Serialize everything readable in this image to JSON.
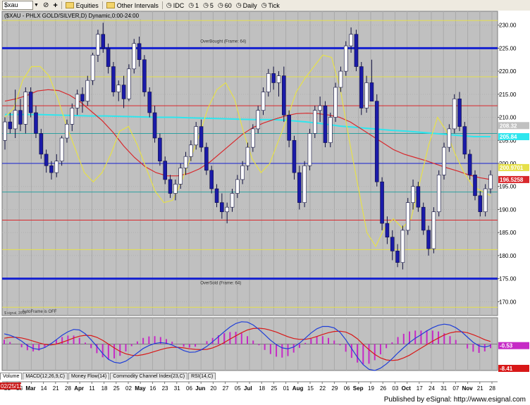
{
  "toolbar": {
    "symbol_value": "$xau",
    "equities_label": "Equities",
    "other_intervals_label": "Other Intervals",
    "intervals": [
      "IDC",
      "1",
      "5",
      "60",
      "Daily",
      "Tick"
    ]
  },
  "footer": {
    "text": "Published by eSignal: http://www.esignal.com"
  },
  "tabs": [
    "Volume",
    "MACD(12,26,9,C)",
    "Money Flow(14)",
    "Commodity Channel Index(23,C)",
    "RSI(14,C)"
  ],
  "colors": {
    "plot_bg": "#c0c0c0",
    "up_candle": "#ffffff",
    "down_candle": "#1a1aa8",
    "ma_cyan": "#2ee6ee",
    "ma_red": "#d8282c",
    "ma_yellow": "#e6e04a",
    "macd_line": "#1f3ed8",
    "signal_line": "#d81818",
    "histogram": "#c62ac6"
  },
  "chart_data": [
    {
      "type": "candlestick",
      "title": "($XAU - PHLX GOLD/SILVER,D) Dynamic,0:00-24:00",
      "ylim": [
        167,
        233
      ],
      "yticks": [
        170,
        175,
        180,
        185,
        190,
        195,
        200,
        205,
        210,
        215,
        220,
        225,
        230
      ],
      "ytick_labels": [
        "170.00",
        "175.00",
        "180.00",
        "185.00",
        "190.00",
        "195.00",
        "200.00",
        "205.00",
        "210.00",
        "215.00",
        "220.00",
        "225.00",
        "230.00"
      ],
      "x_date_labels": [
        "21",
        "28",
        "Mar",
        "14",
        "21",
        "28",
        "Apr",
        "11",
        "18",
        "25",
        "02",
        "May",
        "16",
        "23",
        "31",
        "06",
        "Jun",
        "20",
        "27",
        "05",
        "Jul",
        "18",
        "25",
        "01",
        "Aug",
        "15",
        "22",
        "29",
        "06",
        "Sep",
        "19",
        "26",
        "03",
        "Oct",
        "17",
        "24",
        "31",
        "07",
        "Nov",
        "21",
        "28"
      ],
      "date_box_label": "02/25/11",
      "horizontal_lines": [
        {
          "y": 231.0,
          "color": "#e6e04a",
          "width": 1
        },
        {
          "y": 225.0,
          "color": "#1420d0",
          "width": 3
        },
        {
          "y": 218.8,
          "color": "#e6e04a",
          "width": 1
        },
        {
          "y": 212.5,
          "color": "#d8282c",
          "width": 1
        },
        {
          "y": 206.5,
          "color": "#2ea0a0",
          "width": 1
        },
        {
          "y": 200.0,
          "color": "#1420d0",
          "width": 1
        },
        {
          "y": 193.8,
          "color": "#2ea0a0",
          "width": 1
        },
        {
          "y": 187.7,
          "color": "#d8282c",
          "width": 1
        },
        {
          "y": 181.3,
          "color": "#e6e04a",
          "width": 1
        },
        {
          "y": 175.0,
          "color": "#1420d0",
          "width": 3
        },
        {
          "y": 168.8,
          "color": "#e6e04a",
          "width": 1
        }
      ],
      "annotations": [
        {
          "text": "OverBought (Frame: 64)",
          "x": 40,
          "y": 226.2
        },
        {
          "text": "OverSold (Frame: 64)",
          "x": 40,
          "y": 173.8
        },
        {
          "text": "AutoFrame is OFF",
          "x": 4,
          "y": 167.6
        }
      ],
      "price_labels": [
        {
          "text": "208.32",
          "y": 208.2,
          "bg": "#c0c0c0",
          "fg": "#ffffff"
        },
        {
          "text": "205.84",
          "y": 205.8,
          "bg": "#2ee6ee",
          "fg": "#ffffff"
        },
        {
          "text": "200.9701",
          "y": 199.1,
          "bg": "#e6e04a",
          "fg": "#ffffff"
        },
        {
          "text": "196.5258",
          "y": 196.5,
          "bg": "#d8282c",
          "fg": "#ffffff"
        }
      ],
      "candles": [
        [
          205.0,
          210.0,
          203.0,
          209.0
        ],
        [
          209.0,
          211.0,
          206.5,
          207.5
        ],
        [
          207.5,
          216.0,
          205.5,
          211.5
        ],
        [
          211.5,
          214.0,
          207.0,
          208.5
        ],
        [
          208.5,
          216.5,
          206.5,
          215.5
        ],
        [
          215.5,
          216.5,
          210.0,
          211.0
        ],
        [
          211.0,
          212.5,
          205.5,
          206.5
        ],
        [
          206.5,
          207.5,
          201.0,
          202.0
        ],
        [
          202.0,
          203.0,
          198.0,
          199.5
        ],
        [
          199.5,
          200.5,
          196.5,
          198.0
        ],
        [
          198.0,
          202.0,
          197.0,
          200.5
        ],
        [
          200.5,
          206.0,
          199.5,
          205.5
        ],
        [
          205.5,
          209.5,
          204.5,
          208.5
        ],
        [
          208.5,
          213.0,
          207.0,
          212.0
        ],
        [
          212.0,
          216.0,
          210.5,
          215.0
        ],
        [
          215.0,
          216.5,
          211.0,
          213.5
        ],
        [
          213.5,
          219.0,
          212.5,
          218.0
        ],
        [
          218.0,
          224.0,
          217.0,
          223.5
        ],
        [
          223.5,
          229.0,
          222.0,
          228.0
        ],
        [
          228.0,
          230.5,
          224.0,
          225.0
        ],
        [
          225.0,
          226.0,
          219.5,
          221.0
        ],
        [
          221.0,
          222.0,
          214.5,
          215.5
        ],
        [
          215.5,
          218.0,
          213.5,
          217.0
        ],
        [
          217.0,
          219.0,
          212.0,
          214.0
        ],
        [
          214.0,
          221.5,
          213.5,
          220.5
        ],
        [
          220.5,
          227.0,
          219.5,
          226.0
        ],
        [
          226.0,
          227.5,
          221.0,
          222.5
        ],
        [
          222.5,
          223.5,
          214.5,
          215.5
        ],
        [
          215.5,
          216.5,
          210.0,
          211.0
        ],
        [
          211.0,
          212.5,
          204.5,
          205.5
        ],
        [
          205.5,
          206.5,
          199.5,
          200.5
        ],
        [
          200.5,
          201.5,
          195.5,
          196.5
        ],
        [
          196.5,
          197.5,
          192.5,
          193.5
        ],
        [
          193.5,
          196.5,
          192.0,
          195.5
        ],
        [
          195.5,
          200.0,
          194.5,
          199.0
        ],
        [
          199.0,
          202.5,
          197.5,
          201.5
        ],
        [
          201.5,
          205.0,
          200.5,
          204.0
        ],
        [
          204.0,
          209.0,
          203.0,
          208.0
        ],
        [
          208.0,
          209.5,
          202.5,
          203.5
        ],
        [
          203.5,
          204.5,
          197.5,
          198.5
        ],
        [
          198.5,
          199.5,
          193.5,
          194.5
        ],
        [
          194.5,
          195.5,
          190.5,
          191.5
        ],
        [
          191.5,
          193.5,
          188.0,
          189.5
        ],
        [
          189.5,
          191.5,
          187.0,
          190.5
        ],
        [
          190.5,
          194.5,
          189.5,
          193.5
        ],
        [
          193.5,
          197.5,
          192.5,
          196.5
        ],
        [
          196.5,
          200.5,
          195.5,
          199.5
        ],
        [
          199.5,
          204.5,
          198.5,
          203.5
        ],
        [
          203.5,
          208.5,
          202.5,
          207.5
        ],
        [
          207.5,
          212.5,
          206.5,
          211.5
        ],
        [
          211.5,
          216.5,
          210.5,
          215.5
        ],
        [
          215.5,
          220.5,
          214.5,
          219.5
        ],
        [
          219.5,
          221.0,
          216.0,
          217.5
        ],
        [
          217.5,
          220.0,
          214.5,
          219.0
        ],
        [
          219.0,
          221.0,
          209.0,
          210.5
        ],
        [
          210.5,
          211.5,
          203.5,
          205.0
        ],
        [
          205.0,
          206.0,
          196.5,
          198.0
        ],
        [
          198.0,
          199.5,
          190.0,
          191.5
        ],
        [
          191.5,
          200.5,
          190.5,
          199.5
        ],
        [
          199.5,
          207.5,
          198.5,
          206.5
        ],
        [
          206.5,
          212.5,
          205.5,
          211.5
        ],
        [
          211.5,
          214.5,
          209.0,
          212.5
        ],
        [
          212.5,
          213.5,
          203.5,
          204.5
        ],
        [
          204.5,
          211.0,
          203.5,
          210.0
        ],
        [
          210.0,
          217.5,
          209.0,
          216.5
        ],
        [
          216.5,
          221.0,
          215.5,
          220.0
        ],
        [
          220.0,
          226.5,
          219.0,
          225.5
        ],
        [
          225.5,
          229.5,
          224.0,
          228.0
        ],
        [
          228.0,
          229.0,
          220.0,
          221.0
        ],
        [
          221.0,
          222.0,
          210.5,
          212.0
        ],
        [
          212.0,
          219.0,
          211.0,
          217.5
        ],
        [
          217.5,
          222.5,
          216.0,
          213.5
        ],
        [
          213.5,
          215.0,
          195.0,
          196.0
        ],
        [
          196.0,
          197.0,
          185.5,
          187.0
        ],
        [
          187.0,
          188.5,
          182.5,
          184.0
        ],
        [
          184.0,
          185.5,
          179.0,
          181.0
        ],
        [
          181.0,
          182.5,
          177.5,
          178.5
        ],
        [
          178.5,
          186.5,
          177.0,
          185.5
        ],
        [
          185.5,
          192.5,
          184.5,
          191.5
        ],
        [
          191.5,
          196.5,
          190.0,
          195.0
        ],
        [
          195.0,
          196.0,
          189.5,
          190.5
        ],
        [
          190.5,
          191.5,
          184.5,
          185.5
        ],
        [
          185.5,
          186.5,
          180.0,
          181.5
        ],
        [
          181.5,
          190.5,
          180.5,
          189.5
        ],
        [
          189.5,
          198.5,
          188.5,
          197.5
        ],
        [
          197.5,
          204.5,
          196.5,
          203.5
        ],
        [
          203.5,
          208.5,
          202.5,
          207.5
        ],
        [
          207.5,
          215.0,
          206.5,
          214.0
        ],
        [
          214.0,
          215.5,
          207.0,
          208.0
        ],
        [
          208.0,
          209.0,
          201.0,
          202.0
        ],
        [
          202.0,
          203.0,
          196.5,
          197.5
        ],
        [
          197.5,
          198.5,
          192.0,
          193.0
        ],
        [
          193.0,
          194.0,
          188.5,
          189.5
        ],
        [
          189.5,
          195.5,
          188.5,
          194.5
        ],
        [
          194.5,
          198.5,
          193.5,
          197.5
        ]
      ],
      "ma_series": [
        {
          "color": "#2ee6ee",
          "values": [
            210.6,
            210.6,
            210.6,
            210.5,
            210.4,
            210.3,
            210.3,
            210.2,
            210.1,
            210.0,
            210.0,
            209.9,
            209.8,
            209.7,
            209.6,
            209.5,
            209.5,
            209.3,
            209.0,
            208.6,
            208.1,
            207.8,
            207.5,
            207.2,
            207.0,
            206.7,
            206.4,
            206.1,
            205.8,
            205.8
          ]
        },
        {
          "color": "#d8282c",
          "values": [
            213.5,
            214.0,
            214.7,
            215.7,
            216.0,
            215.8,
            214.8,
            213.3,
            211.3,
            209.3,
            206.8,
            203.8,
            201.3,
            199.3,
            198.0,
            197.3,
            197.3,
            197.8,
            198.8,
            200.3,
            202.3,
            204.3,
            206.3,
            207.8,
            208.8,
            209.6,
            210.3,
            210.8,
            210.9,
            210.8,
            210.5,
            210.0,
            209.0,
            207.5,
            206.0,
            204.5,
            203.0,
            202.0,
            201.3,
            200.6,
            199.8,
            199.0,
            198.3,
            197.5,
            196.9,
            196.5
          ]
        },
        {
          "color": "#e6e04a",
          "values": [
            210.0,
            212.0,
            218.0,
            221.0,
            221.0,
            219.0,
            214.0,
            208.0,
            203.0,
            198.0,
            196.0,
            198.0,
            202.0,
            207.0,
            208.0,
            204.0,
            199.0,
            194.0,
            191.5,
            192.0,
            196.0,
            201.0,
            206.0,
            212.0,
            216.0,
            217.5,
            214.0,
            207.0,
            201.0,
            198.0,
            200.0,
            205.0,
            210.0,
            215.5,
            218.5,
            221.0,
            223.5,
            223.0,
            216.0,
            205.0,
            195.0,
            185.0,
            182.0,
            186.0,
            188.0,
            186.0,
            188.0,
            196.0,
            204.0,
            210.0,
            207.0,
            202.0,
            198.0,
            195.0,
            194.0,
            193.0
          ]
        }
      ],
      "legend_label": "$ signal, 2010"
    },
    {
      "type": "macd",
      "ylim": [
        -9,
        9
      ],
      "macd_label": "-0.53",
      "signal_label": "-8.41",
      "macd": [
        3.5,
        3.0,
        2.2,
        1.0,
        -0.5,
        -1.5,
        -1.8,
        -1.2,
        0.0,
        1.5,
        3.0,
        4.2,
        5.0,
        4.8,
        3.5,
        1.5,
        -0.8,
        -3.2,
        -5.2,
        -6.2,
        -6.5,
        -5.8,
        -4.5,
        -3.0,
        -1.5,
        -0.5,
        0.2,
        0.5,
        0.3,
        -0.3,
        -1.2,
        -2.2,
        -2.8,
        -2.7,
        -2.0,
        -0.8,
        0.8,
        2.5,
        4.2,
        5.8,
        7.0,
        7.6,
        7.5,
        6.5,
        5.0,
        3.2,
        1.3,
        -0.2,
        -1.3,
        -1.6,
        -1.0,
        0.3,
        2.0,
        3.8,
        5.2,
        6.0,
        6.0,
        5.5,
        4.0,
        1.5,
        -1.5,
        -4.5,
        -7.0,
        -8.6,
        -9.0,
        -8.2,
        -6.8,
        -5.0,
        -3.0,
        -1.2,
        0.5,
        2.0,
        3.2,
        4.5,
        5.6,
        6.4,
        6.8,
        6.5,
        5.6,
        4.2,
        2.4,
        0.6,
        -0.6,
        -1.0,
        -0.5
      ],
      "signal": [
        2.0,
        2.3,
        2.3,
        2.1,
        1.6,
        1.0,
        0.4,
        -0.1,
        -0.3,
        0.0,
        0.6,
        1.3,
        2.1,
        2.7,
        3.0,
        2.9,
        2.3,
        1.3,
        0.0,
        -1.3,
        -2.5,
        -3.3,
        -3.8,
        -3.9,
        -3.6,
        -3.1,
        -2.5,
        -1.9,
        -1.4,
        -1.1,
        -1.1,
        -1.3,
        -1.6,
        -1.8,
        -1.9,
        -1.8,
        -1.3,
        -0.5,
        0.5,
        1.7,
        2.8,
        3.9,
        4.8,
        5.3,
        5.4,
        5.2,
        4.7,
        4.1,
        3.3,
        2.5,
        1.9,
        1.6,
        1.6,
        2.0,
        2.6,
        3.3,
        3.9,
        4.3,
        4.4,
        4.1,
        3.2,
        1.8,
        -0.1,
        -1.9,
        -3.5,
        -4.7,
        -5.4,
        -5.6,
        -5.4,
        -4.7,
        -3.8,
        -2.6,
        -1.4,
        -0.2,
        1.0,
        2.1,
        3.1,
        3.8,
        4.2,
        4.2,
        3.9,
        3.2,
        2.4,
        1.5,
        0.9
      ]
    }
  ]
}
